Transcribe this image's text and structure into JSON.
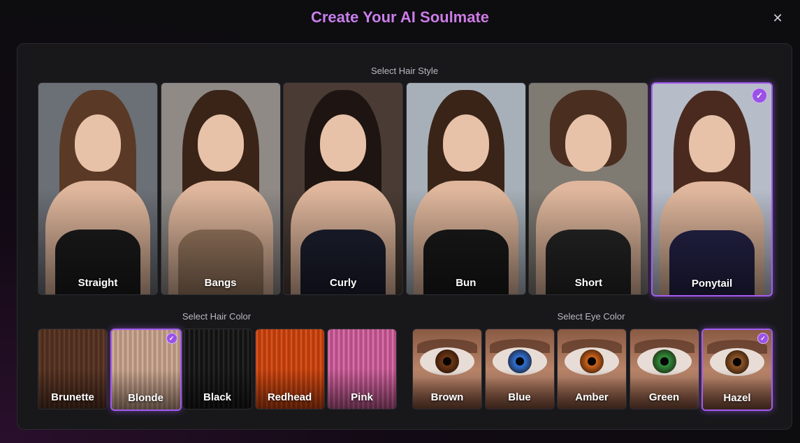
{
  "title": "Create Your AI Soulmate",
  "close_icon": "close-icon",
  "hair_style": {
    "label": "Select Hair Style",
    "selected": "Ponytail",
    "options": [
      {
        "label": "Straight",
        "hair": "#5a3a26",
        "garment": "#1c1c1c",
        "bg": "#6b6f76"
      },
      {
        "label": "Bangs",
        "hair": "#3a2418",
        "garment": "#a07e64",
        "bg": "#8f8a86"
      },
      {
        "label": "Curly",
        "hair": "#1e1512",
        "garment": "#1d2030",
        "bg": "#4a3c34"
      },
      {
        "label": "Bun",
        "hair": "#3a2418",
        "garment": "#1a1a1a",
        "bg": "#a7b0b8"
      },
      {
        "label": "Short",
        "hair": "#4a2f20",
        "garment": "#262626",
        "bg": "#7f7a72"
      },
      {
        "label": "Ponytail",
        "hair": "#4a2a1e",
        "garment": "#25244a",
        "bg": "#b6bcc8"
      }
    ]
  },
  "hair_color": {
    "label": "Select Hair Color",
    "selected": "Blonde",
    "options": [
      {
        "label": "Brunette",
        "color": "#4b2c1d",
        "stripe": "#6a4230"
      },
      {
        "label": "Blonde",
        "color": "#b28f7a",
        "stripe": "#d8b8a5"
      },
      {
        "label": "Black",
        "color": "#121212",
        "stripe": "#2c2c2c"
      },
      {
        "label": "Redhead",
        "color": "#b53a0d",
        "stripe": "#e35d20"
      },
      {
        "label": "Pink",
        "color": "#b54d84",
        "stripe": "#e07fb6"
      }
    ]
  },
  "eye_color": {
    "label": "Select Eye Color",
    "selected": "Hazel",
    "options": [
      {
        "label": "Brown",
        "iris": "#6b3514"
      },
      {
        "label": "Blue",
        "iris": "#2f6fd0"
      },
      {
        "label": "Amber",
        "iris": "#c7601b"
      },
      {
        "label": "Green",
        "iris": "#2f8a3a"
      },
      {
        "label": "Hazel",
        "iris": "#8a5224"
      }
    ]
  },
  "check_icon": "check-icon"
}
